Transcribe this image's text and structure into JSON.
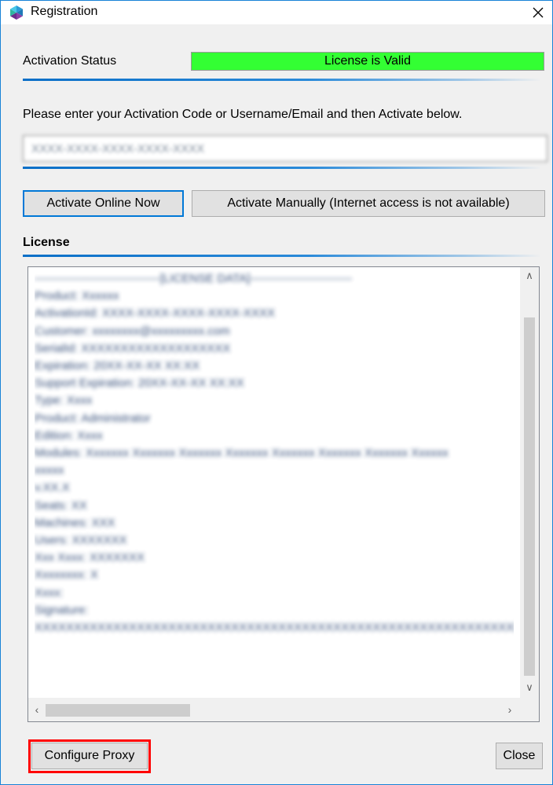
{
  "window": {
    "title": "Registration",
    "icon": "app-logo-icon",
    "close_glyph": "✕"
  },
  "activation": {
    "status_label": "Activation Status",
    "status_value": "License is Valid",
    "status_color": "#33ff33",
    "prompt": "Please enter your Activation Code or Username/Email and then Activate below.",
    "code_value": "XXXX-XXXX-XXXX-XXXX-XXXX"
  },
  "buttons": {
    "activate_online": "Activate Online Now",
    "activate_manually": "Activate Manually (Internet access is not available)",
    "configure_proxy": "Configure Proxy",
    "close": "Close"
  },
  "license": {
    "title": "License",
    "lines": [
      "--------------------------------[LICENSE DATA]--------------------------",
      "Product: Xxxxxx",
      "ActivationId: XXXX-XXXX-XXXX-XXXX-XXXX",
      "Customer: xxxxxxxx@xxxxxxxxx.com",
      "SerialId: XXXXXXXXXXXXXXXXXXX",
      "Expiration: 20XX-XX-XX XX:XX",
      "Support Expiration: 20XX-XX-XX XX:XX",
      "Type: Xxxx",
      "Product: Administrator",
      "Edition: Xxxx",
      "Modules: Xxxxxxx Xxxxxxx Xxxxxxx Xxxxxxx Xxxxxxx Xxxxxxx Xxxxxxx Xxxxxx",
      "xxxxx",
      "v.XX.X",
      "Seats: XX",
      "Machines: XXX",
      "Users: XXXXXXX",
      "Xxx Xxxx: XXXXXXX",
      "Xxxxxxxx: X",
      "Xxxx:",
      "Signature:",
      "XXXXXXXXXXXXXXXXXXXXXXXXXXXXXXXXXXXXXXXXXXXXXXXXXXXXXXXXXXXXXXXX"
    ]
  }
}
